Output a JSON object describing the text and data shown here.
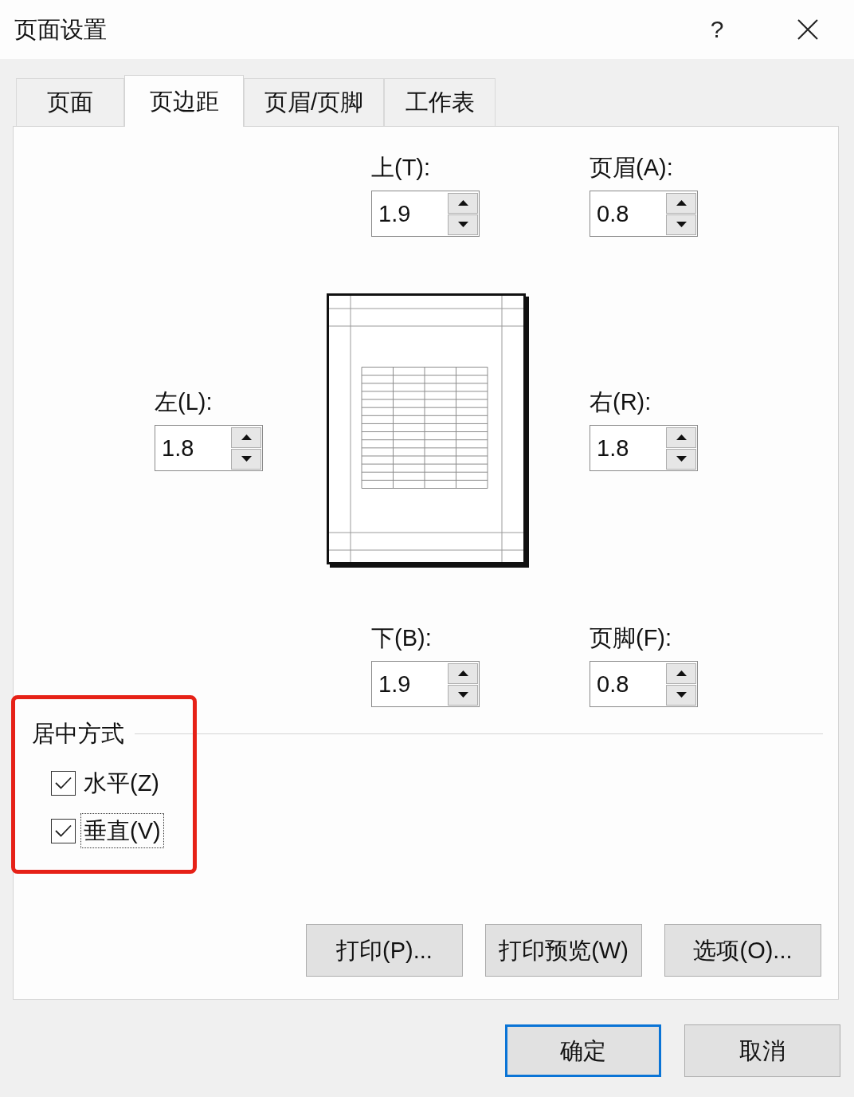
{
  "window": {
    "title": "页面设置",
    "help_label": "?"
  },
  "tabs": [
    {
      "label": "页面",
      "selected": false
    },
    {
      "label": "页边距",
      "selected": true
    },
    {
      "label": "页眉/页脚",
      "selected": false
    },
    {
      "label": "工作表",
      "selected": false
    }
  ],
  "margins": {
    "top": {
      "label": "上(T):",
      "value": "1.9"
    },
    "header": {
      "label": "页眉(A):",
      "value": "0.8"
    },
    "left": {
      "label": "左(L):",
      "value": "1.8"
    },
    "right": {
      "label": "右(R):",
      "value": "1.8"
    },
    "bottom": {
      "label": "下(B):",
      "value": "1.9"
    },
    "footer": {
      "label": "页脚(F):",
      "value": "0.8"
    }
  },
  "centering": {
    "title": "居中方式",
    "highlighted": true,
    "options": [
      {
        "label": "水平(Z)",
        "checked": true,
        "focused": false
      },
      {
        "label": "垂直(V)",
        "checked": true,
        "focused": true
      }
    ]
  },
  "panel_buttons": [
    {
      "label": "打印(P)..."
    },
    {
      "label": "打印预览(W)"
    },
    {
      "label": "选项(O)..."
    }
  ],
  "dialog_buttons": [
    {
      "label": "确定",
      "default": true
    },
    {
      "label": "取消",
      "default": false
    }
  ]
}
